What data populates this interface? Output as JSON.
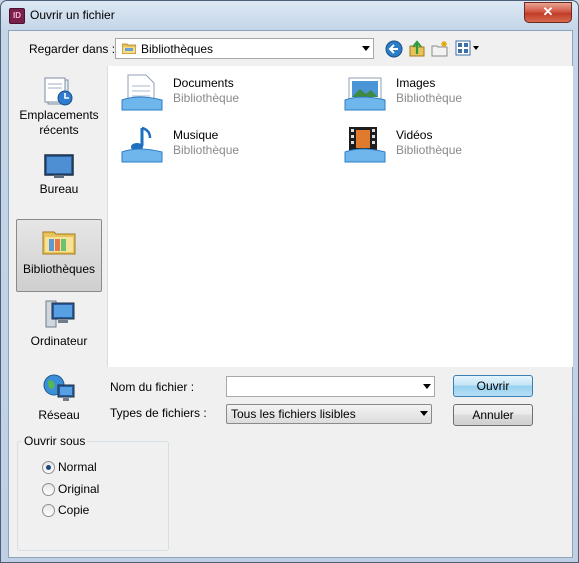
{
  "window": {
    "title": "Ouvrir un fichier",
    "app_icon_text": "ID",
    "close_glyph": "✕"
  },
  "toolbar": {
    "look_in_label": "Regarder dans :",
    "look_in_value": "Bibliothèques",
    "buttons": [
      "back-icon",
      "up-folder-icon",
      "new-folder-icon",
      "view-menu-icon"
    ]
  },
  "places": [
    {
      "label": "Emplacements\nrécents",
      "icon": "recent-places-icon"
    },
    {
      "label": "Bureau",
      "icon": "desktop-icon"
    },
    {
      "label": "Bibliothèques",
      "icon": "libraries-icon",
      "selected": true
    },
    {
      "label": "Ordinateur",
      "icon": "computer-icon"
    },
    {
      "label": "Réseau",
      "icon": "network-icon"
    }
  ],
  "files": [
    {
      "name": "Documents",
      "type": "Bibliothèque",
      "icon": "documents-library-icon"
    },
    {
      "name": "Images",
      "type": "Bibliothèque",
      "icon": "pictures-library-icon"
    },
    {
      "name": "Musique",
      "type": "Bibliothèque",
      "icon": "music-library-icon"
    },
    {
      "name": "Vidéos",
      "type": "Bibliothèque",
      "icon": "videos-library-icon"
    }
  ],
  "form": {
    "filename_label": "Nom du fichier :",
    "filename_value": "",
    "filetype_label": "Types de fichiers :",
    "filetype_value": "Tous les fichiers lisibles",
    "open_button": "Ouvrir",
    "cancel_button": "Annuler"
  },
  "open_as": {
    "legend": "Ouvrir sous",
    "options": [
      {
        "label": "Normal",
        "checked": true
      },
      {
        "label": "Original",
        "checked": false
      },
      {
        "label": "Copie",
        "checked": false
      }
    ]
  },
  "colors": {
    "selection_border": "#3c7fb1",
    "close_button": "#c23b27"
  }
}
